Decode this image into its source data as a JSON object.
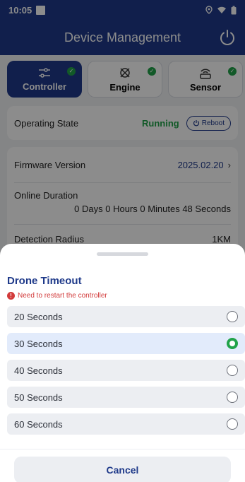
{
  "status_bar": {
    "time": "10:05"
  },
  "app_bar": {
    "title": "Device Management",
    "power_icon": "power-icon"
  },
  "tabs": [
    {
      "label": "Controller",
      "icon": "sliders-icon",
      "active": true
    },
    {
      "label": "Engine",
      "icon": "engine-icon",
      "active": false
    },
    {
      "label": "Sensor",
      "icon": "sensor-icon",
      "active": false
    }
  ],
  "operating": {
    "label": "Operating State",
    "state": "Running",
    "reboot_label": "Reboot"
  },
  "info": {
    "firmware_label": "Firmware Version",
    "firmware_value": "2025.02.20",
    "online_label": "Online Duration",
    "online_value": "0 Days 0 Hours 0 Minutes 48 Seconds",
    "radius_label": "Detection Radius",
    "radius_value": "1KM"
  },
  "sheet": {
    "title": "Drone Timeout",
    "warning": "Need to restart the controller",
    "options": [
      {
        "label": "20 Seconds",
        "selected": false
      },
      {
        "label": "30 Seconds",
        "selected": true
      },
      {
        "label": "40 Seconds",
        "selected": false
      },
      {
        "label": "50 Seconds",
        "selected": false
      },
      {
        "label": "60 Seconds",
        "selected": false
      }
    ],
    "cancel_label": "Cancel"
  },
  "colors": {
    "primary": "#1f3a8a",
    "success": "#21a34a",
    "warning": "#d23b3b"
  }
}
